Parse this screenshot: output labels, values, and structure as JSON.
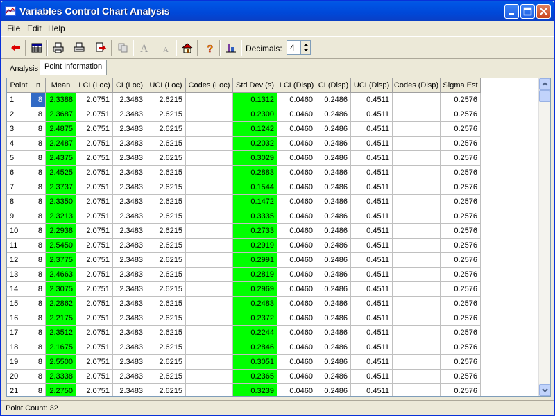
{
  "window": {
    "title": "Variables Control Chart Analysis"
  },
  "menu": {
    "file": "File",
    "edit": "Edit",
    "help": "Help"
  },
  "toolbar": {
    "decimals_label": "Decimals:",
    "decimals_value": "4",
    "icons": [
      "back-arrow-icon",
      "table-icon",
      "print-preview-icon",
      "print-icon",
      "export-icon",
      "copy-disabled-icon",
      "font-larger-icon",
      "font-smaller-icon",
      "home-icon",
      "help-icon",
      "chart-icon"
    ]
  },
  "tabs": [
    "Analysis",
    "Point Information"
  ],
  "grid": {
    "headers": [
      "Point",
      "n",
      "Mean",
      "LCL(Loc)",
      "CL(Loc)",
      "UCL(Loc)",
      "Codes (Loc)",
      "Std Dev (s)",
      "LCL(Disp)",
      "CL(Disp)",
      "UCL(Disp)",
      "Codes (Disp)",
      "Sigma Est"
    ],
    "rows": [
      [
        "1",
        "8",
        "2.3388",
        "2.0751",
        "2.3483",
        "2.6215",
        "",
        "0.1312",
        "0.0460",
        "0.2486",
        "0.4511",
        "",
        "0.2576"
      ],
      [
        "2",
        "8",
        "2.3687",
        "2.0751",
        "2.3483",
        "2.6215",
        "",
        "0.2300",
        "0.0460",
        "0.2486",
        "0.4511",
        "",
        "0.2576"
      ],
      [
        "3",
        "8",
        "2.4875",
        "2.0751",
        "2.3483",
        "2.6215",
        "",
        "0.1242",
        "0.0460",
        "0.2486",
        "0.4511",
        "",
        "0.2576"
      ],
      [
        "4",
        "8",
        "2.2487",
        "2.0751",
        "2.3483",
        "2.6215",
        "",
        "0.2032",
        "0.0460",
        "0.2486",
        "0.4511",
        "",
        "0.2576"
      ],
      [
        "5",
        "8",
        "2.4375",
        "2.0751",
        "2.3483",
        "2.6215",
        "",
        "0.3029",
        "0.0460",
        "0.2486",
        "0.4511",
        "",
        "0.2576"
      ],
      [
        "6",
        "8",
        "2.4525",
        "2.0751",
        "2.3483",
        "2.6215",
        "",
        "0.2883",
        "0.0460",
        "0.2486",
        "0.4511",
        "",
        "0.2576"
      ],
      [
        "7",
        "8",
        "2.3737",
        "2.0751",
        "2.3483",
        "2.6215",
        "",
        "0.1544",
        "0.0460",
        "0.2486",
        "0.4511",
        "",
        "0.2576"
      ],
      [
        "8",
        "8",
        "2.3350",
        "2.0751",
        "2.3483",
        "2.6215",
        "",
        "0.1472",
        "0.0460",
        "0.2486",
        "0.4511",
        "",
        "0.2576"
      ],
      [
        "9",
        "8",
        "2.3213",
        "2.0751",
        "2.3483",
        "2.6215",
        "",
        "0.3335",
        "0.0460",
        "0.2486",
        "0.4511",
        "",
        "0.2576"
      ],
      [
        "10",
        "8",
        "2.2938",
        "2.0751",
        "2.3483",
        "2.6215",
        "",
        "0.2733",
        "0.0460",
        "0.2486",
        "0.4511",
        "",
        "0.2576"
      ],
      [
        "11",
        "8",
        "2.5450",
        "2.0751",
        "2.3483",
        "2.6215",
        "",
        "0.2919",
        "0.0460",
        "0.2486",
        "0.4511",
        "",
        "0.2576"
      ],
      [
        "12",
        "8",
        "2.3775",
        "2.0751",
        "2.3483",
        "2.6215",
        "",
        "0.2991",
        "0.0460",
        "0.2486",
        "0.4511",
        "",
        "0.2576"
      ],
      [
        "13",
        "8",
        "2.4663",
        "2.0751",
        "2.3483",
        "2.6215",
        "",
        "0.2819",
        "0.0460",
        "0.2486",
        "0.4511",
        "",
        "0.2576"
      ],
      [
        "14",
        "8",
        "2.3075",
        "2.0751",
        "2.3483",
        "2.6215",
        "",
        "0.2969",
        "0.0460",
        "0.2486",
        "0.4511",
        "",
        "0.2576"
      ],
      [
        "15",
        "8",
        "2.2862",
        "2.0751",
        "2.3483",
        "2.6215",
        "",
        "0.2483",
        "0.0460",
        "0.2486",
        "0.4511",
        "",
        "0.2576"
      ],
      [
        "16",
        "8",
        "2.2175",
        "2.0751",
        "2.3483",
        "2.6215",
        "",
        "0.2372",
        "0.0460",
        "0.2486",
        "0.4511",
        "",
        "0.2576"
      ],
      [
        "17",
        "8",
        "2.3512",
        "2.0751",
        "2.3483",
        "2.6215",
        "",
        "0.2244",
        "0.0460",
        "0.2486",
        "0.4511",
        "",
        "0.2576"
      ],
      [
        "18",
        "8",
        "2.1675",
        "2.0751",
        "2.3483",
        "2.6215",
        "",
        "0.2846",
        "0.0460",
        "0.2486",
        "0.4511",
        "",
        "0.2576"
      ],
      [
        "19",
        "8",
        "2.5500",
        "2.0751",
        "2.3483",
        "2.6215",
        "",
        "0.3051",
        "0.0460",
        "0.2486",
        "0.4511",
        "",
        "0.2576"
      ],
      [
        "20",
        "8",
        "2.3338",
        "2.0751",
        "2.3483",
        "2.6215",
        "",
        "0.2365",
        "0.0460",
        "0.2486",
        "0.4511",
        "",
        "0.2576"
      ],
      [
        "21",
        "8",
        "2.2750",
        "2.0751",
        "2.3483",
        "2.6215",
        "",
        "0.3239",
        "0.0460",
        "0.2486",
        "0.4511",
        "",
        "0.2576"
      ]
    ]
  },
  "status": {
    "text": "Point Count: 32"
  },
  "colors": {
    "highlight": "#00ff00",
    "selection": "#316ac5"
  }
}
